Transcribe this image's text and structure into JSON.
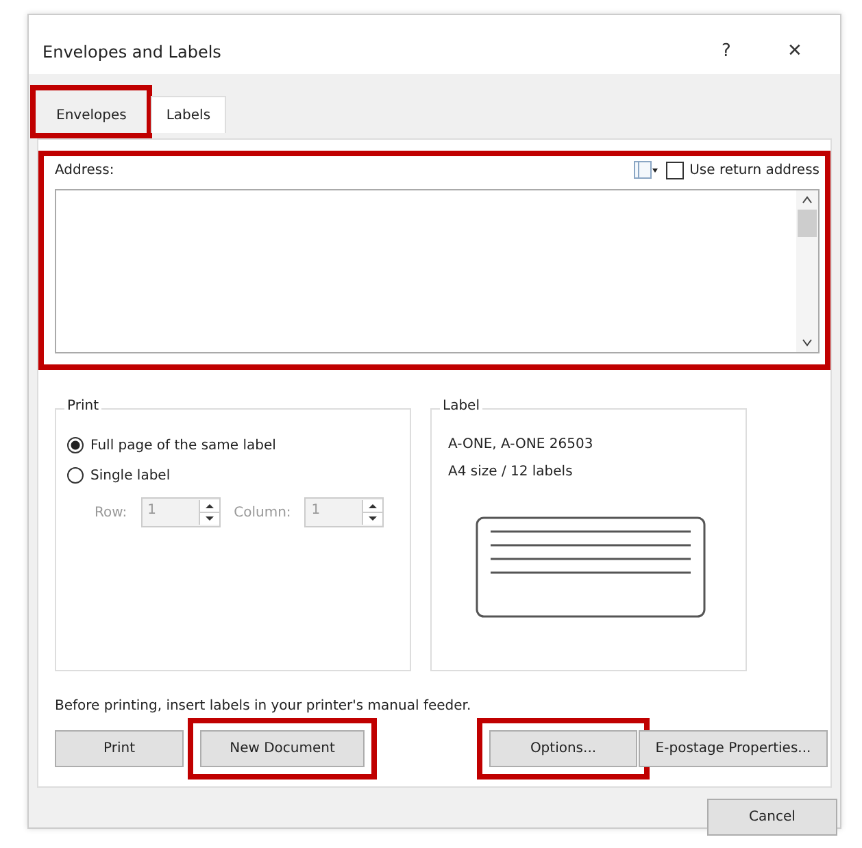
{
  "window": {
    "title": "Envelopes and Labels",
    "help": "?",
    "close": "✕"
  },
  "tabs": [
    {
      "label": "Envelopes",
      "selected": false,
      "highlighted": true
    },
    {
      "label": "Labels",
      "selected": true,
      "highlighted": false
    }
  ],
  "address": {
    "label": "Address:",
    "highlighted": true,
    "use_return_address": {
      "label": "Use return address",
      "checked": false
    }
  },
  "print": {
    "title": "Print",
    "options": [
      {
        "label": "Full page of the same label",
        "selected": true
      },
      {
        "label": "Single label",
        "selected": false
      }
    ],
    "spinners": [
      {
        "label": "Row:",
        "value": "1",
        "disabled": true
      },
      {
        "label": "Column:",
        "value": "1",
        "disabled": true
      }
    ]
  },
  "label": {
    "title": "Label",
    "lines": [
      "A-ONE, A-ONE 26503",
      "A4 size / 12 labels"
    ]
  },
  "note": "Before printing, insert labels in your printer's manual feeder.",
  "buttons": [
    {
      "label": "Print",
      "highlighted": false
    },
    {
      "label": "New Document",
      "highlighted": true
    },
    {
      "label": "Options...",
      "highlighted": true
    },
    {
      "label": "E-postage Properties...",
      "highlighted": false
    }
  ],
  "footer_buttons": [
    {
      "label": "Cancel"
    }
  ]
}
